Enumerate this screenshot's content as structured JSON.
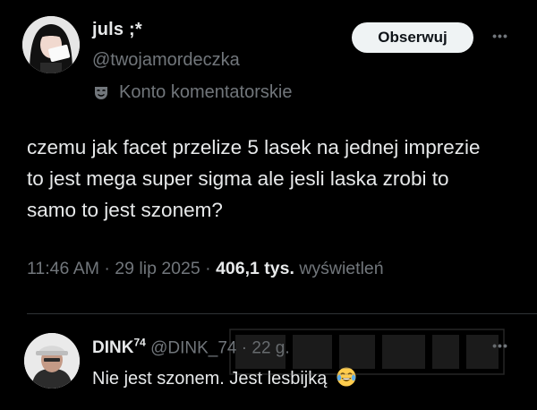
{
  "post": {
    "author_name": "juls ;*",
    "author_handle": "@twojamordeczka",
    "follow_label": "Obserwuj",
    "badge_label": "Konto komentatorskie",
    "text": "czemu jak facet przelize 5 lasek na jednej imprezie to jest mega super sigma ale jesli laska zrobi to samo to jest szonem?",
    "time": "11:46 AM",
    "date": "29 lip 2025",
    "views_count": "406,1 tys.",
    "views_label": "wyświetleń",
    "separator": "·",
    "more_label": "•••"
  },
  "reply": {
    "author_name": "DINK",
    "author_sup": "74",
    "author_handle": "@DINK_74",
    "time": "22 g.",
    "separator": "·",
    "text": "Nie jest szonem. Jest lesbijką",
    "emoji": "face-with-tears-of-joy",
    "more_label": "•••"
  },
  "icons": {
    "badge": "theater-masks-icon",
    "more": "more-horizontal-icon"
  },
  "colors": {
    "background": "#000000",
    "text_primary": "#e7e9ea",
    "text_secondary": "#71767b",
    "follow_bg": "#eff3f4",
    "divider": "#2f3336"
  }
}
